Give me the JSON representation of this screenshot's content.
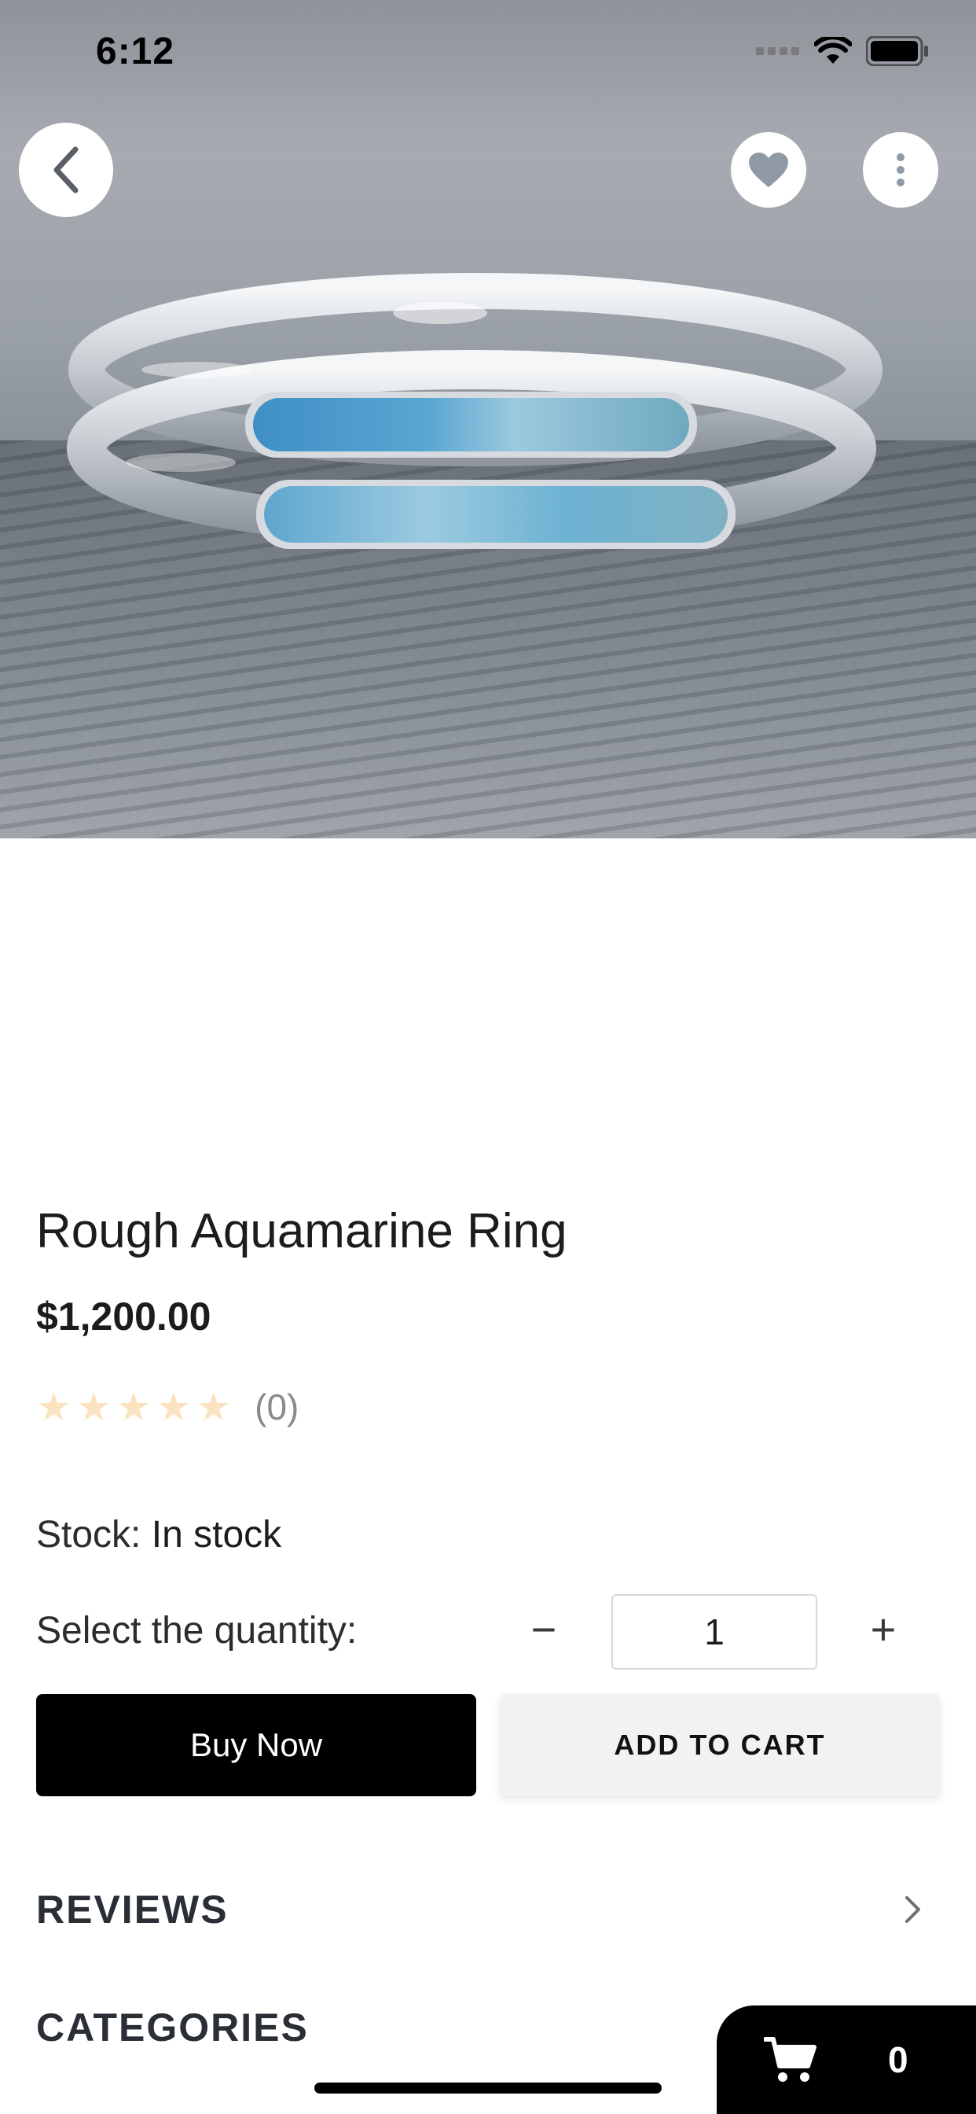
{
  "status_bar": {
    "time": "6:12"
  },
  "product": {
    "title": "Rough Aquamarine Ring",
    "price": "$1,200.00",
    "rating": {
      "stars_filled": 0,
      "stars_total": 5,
      "count": "(0)",
      "star_color": "#fbe3c2"
    },
    "stock_label": "Stock:",
    "stock_value": "In stock",
    "quantity_label": "Select the quantity:",
    "quantity": "1",
    "minus_symbol": "−",
    "plus_symbol": "+"
  },
  "actions": {
    "buy_now": "Buy Now",
    "add_to_cart": "ADD TO CART"
  },
  "sections": {
    "reviews": "REVIEWS",
    "categories": "CATEGORIES"
  },
  "cart": {
    "count": "0"
  },
  "icons": {
    "back": "chevron-left-icon",
    "favorite": "heart-icon",
    "more": "more-vertical-icon",
    "reviews_chevron": "chevron-right-icon",
    "cart": "shopping-cart-icon"
  },
  "colors": {
    "primary_button": "#000000",
    "secondary_button": "#f2f2f4",
    "text": "#1c1c1e"
  }
}
